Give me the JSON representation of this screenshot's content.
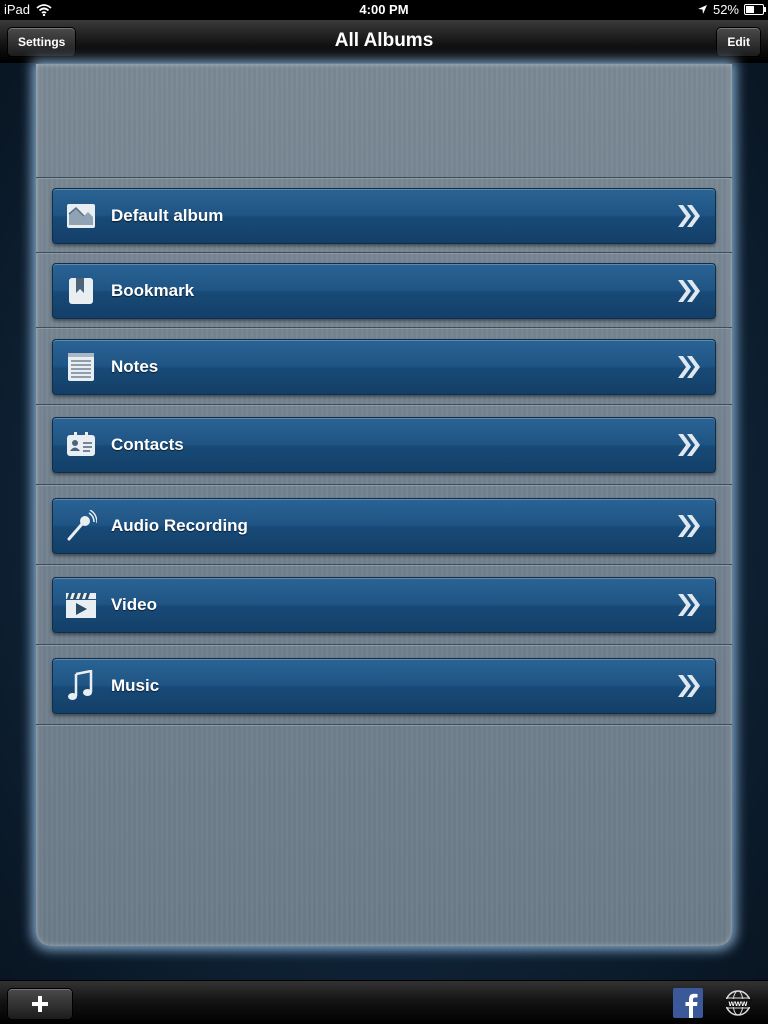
{
  "status_bar": {
    "device": "iPad",
    "time": "4:00 PM",
    "battery": "52%",
    "battery_level": 0.52
  },
  "nav": {
    "title": "All Albums",
    "left_button": "Settings",
    "right_button": "Edit"
  },
  "albums": [
    {
      "label": "Default album",
      "icon": "landscape-icon"
    },
    {
      "label": "Bookmark",
      "icon": "bookmark-icon"
    },
    {
      "label": "Notes",
      "icon": "notes-icon"
    },
    {
      "label": "Contacts",
      "icon": "contact-card-icon"
    },
    {
      "label": "Audio Recording",
      "icon": "microphone-icon"
    },
    {
      "label": "Video",
      "icon": "clapperboard-icon"
    },
    {
      "label": "Music",
      "icon": "music-note-icon"
    }
  ],
  "bottom_bar": {
    "add_icon": "plus-icon",
    "facebook_icon": "facebook-icon",
    "web_icon": "globe-www-icon",
    "web_label": "www"
  },
  "colors": {
    "row_blue": "#1f5585",
    "panel_glow": "#aad7ff"
  }
}
